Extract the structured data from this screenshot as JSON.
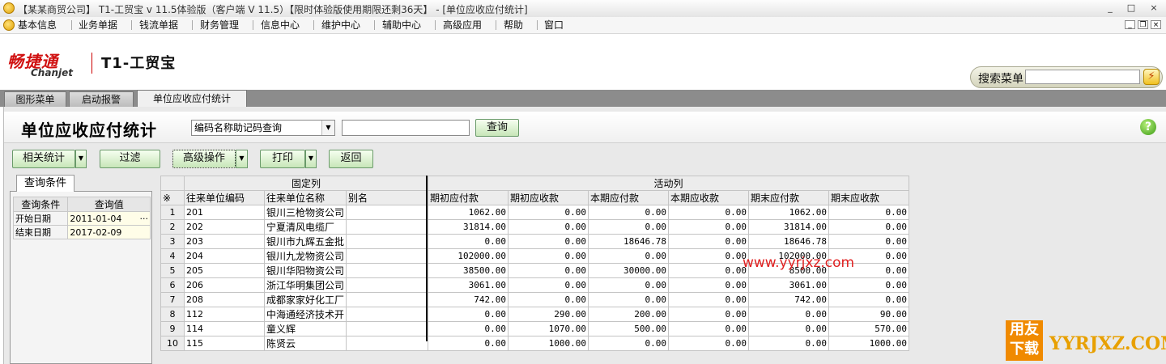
{
  "window": {
    "title": "【某某商贸公司】 T1-工贸宝 v 11.5体验版（客户端 V 11.5）【限时体验版使用期限还剩36天】 - [单位应收应付统计]",
    "controls": [
      "_",
      "□",
      "×"
    ]
  },
  "menu": {
    "items": [
      "基本信息",
      "业务单据",
      "钱流单据",
      "财务管理",
      "信息中心",
      "维护中心",
      "辅助中心",
      "高级应用",
      "帮助",
      "窗口"
    ]
  },
  "brand": {
    "logo_cn": "畅捷通",
    "logo_en": "Chanjet",
    "product": "T1-工贸宝"
  },
  "search_menu": {
    "label": "搜索菜单",
    "value": ""
  },
  "tabs": [
    "图形菜单",
    "启动报警",
    "单位应收应付统计"
  ],
  "page": {
    "title": "单位应收应付统计",
    "search_mode": "编码名称助记码查询",
    "search_value": "",
    "query_label": "查询",
    "help": "?"
  },
  "toolbar": {
    "related": "相关统计",
    "filter": "过滤",
    "advanced": "高级操作",
    "print": "打印",
    "back": "返回"
  },
  "conditions": {
    "tab_label": "查询条件",
    "headers": [
      "查询条件",
      "查询值"
    ],
    "rows": [
      {
        "name": "开始日期",
        "value": "2011-01-04",
        "button": "···"
      },
      {
        "name": "结束日期",
        "value": "2017-02-09",
        "button": ""
      }
    ]
  },
  "grid": {
    "group_fixed": "固定列",
    "group_active": "活动列",
    "corner": "※",
    "columns": [
      "往来单位编码",
      "往来单位名称",
      "别名",
      "期初应付款",
      "期初应收款",
      "本期应付款",
      "本期应收款",
      "期末应付款",
      "期末应收款"
    ],
    "rows": [
      [
        "1",
        "201",
        "银川三枪物资公司",
        "",
        "1062.00",
        "0.00",
        "0.00",
        "0.00",
        "1062.00",
        "0.00"
      ],
      [
        "2",
        "202",
        "宁夏清风电缆厂",
        "",
        "31814.00",
        "0.00",
        "0.00",
        "0.00",
        "31814.00",
        "0.00"
      ],
      [
        "3",
        "203",
        "银川市九辉五金批",
        "",
        "0.00",
        "0.00",
        "18646.78",
        "0.00",
        "18646.78",
        "0.00"
      ],
      [
        "4",
        "204",
        "银川九龙物资公司",
        "",
        "102000.00",
        "0.00",
        "0.00",
        "0.00",
        "102000.00",
        "0.00"
      ],
      [
        "5",
        "205",
        "银川华阳物资公司",
        "",
        "38500.00",
        "0.00",
        "30000.00",
        "0.00",
        "8500.00",
        "0.00"
      ],
      [
        "6",
        "206",
        "浙江华明集团公司",
        "",
        "3061.00",
        "0.00",
        "0.00",
        "0.00",
        "3061.00",
        "0.00"
      ],
      [
        "7",
        "208",
        "成都家家好化工厂",
        "",
        "742.00",
        "0.00",
        "0.00",
        "0.00",
        "742.00",
        "0.00"
      ],
      [
        "8",
        "112",
        "中海通经济技术开",
        "",
        "0.00",
        "290.00",
        "200.00",
        "0.00",
        "0.00",
        "90.00"
      ],
      [
        "9",
        "114",
        "童义辉",
        "",
        "0.00",
        "1070.00",
        "500.00",
        "0.00",
        "0.00",
        "570.00"
      ],
      [
        "10",
        "115",
        "陈贤云",
        "",
        "0.00",
        "1000.00",
        "0.00",
        "0.00",
        "0.00",
        "1000.00"
      ]
    ]
  },
  "watermark": "www.yyrjxz.com",
  "corner_brand": {
    "box": "用友下载",
    "text": "YYRJXZ.COM"
  },
  "colors": {
    "accent_green": "#c7e6b8",
    "logo_red": "#d01010",
    "brand_orange": "#f08a00"
  }
}
